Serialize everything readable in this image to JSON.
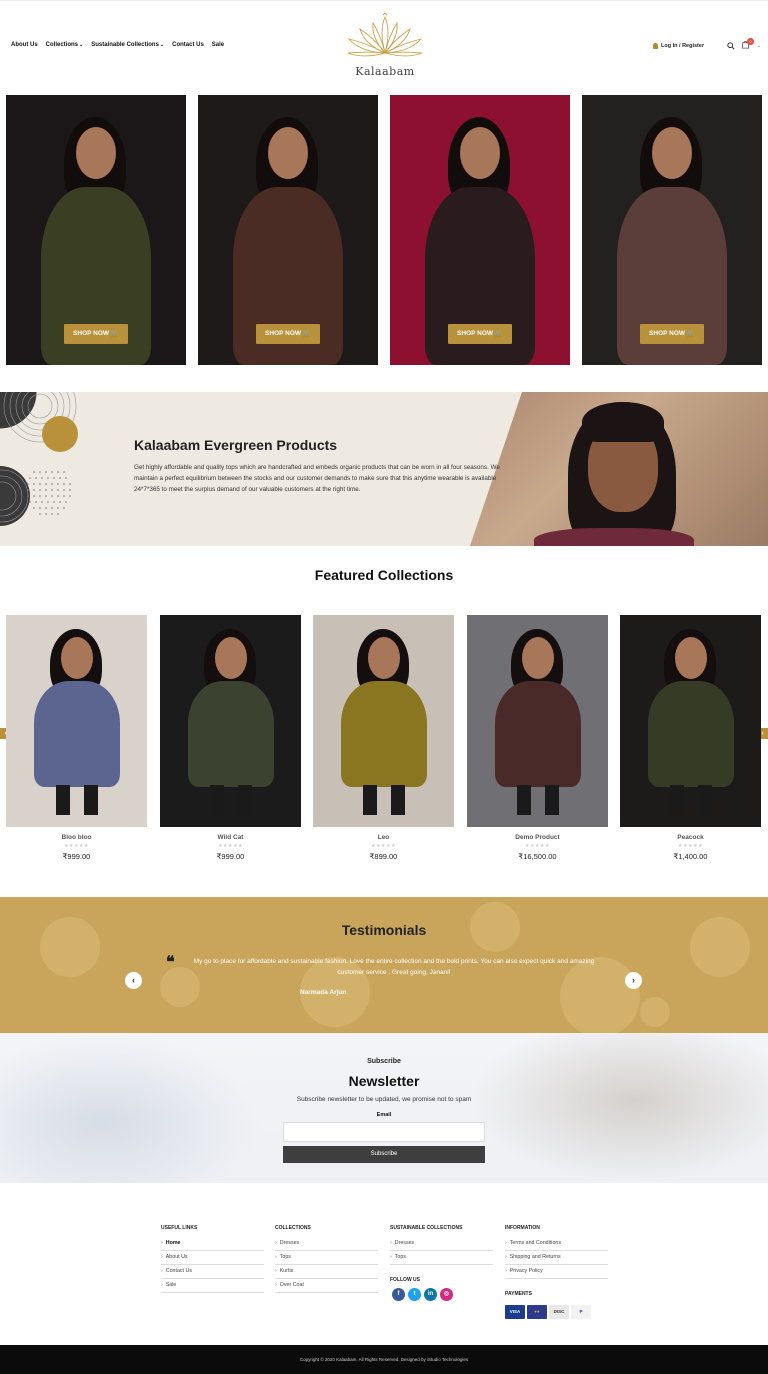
{
  "header": {
    "nav": [
      {
        "label": "About Us",
        "has_dropdown": false
      },
      {
        "label": "Collections",
        "has_dropdown": true
      },
      {
        "label": "Sustainable Collections",
        "has_dropdown": true
      },
      {
        "label": "Contact Us",
        "has_dropdown": false
      },
      {
        "label": "Sale",
        "has_dropdown": false
      }
    ],
    "logo_text": "Kalaabam",
    "login_label": "Log In / Register",
    "cart_count": "0"
  },
  "hero": {
    "cards": [
      {
        "button": "SHOP NOW",
        "bg": "#1b1718",
        "outfit": "#3a3f24"
      },
      {
        "button": "SHOP NOW",
        "bg": "#1e1a19",
        "outfit": "#4a2c24"
      },
      {
        "button": "SHOP NOW",
        "bg": "#8e1030",
        "outfit": "#2a1c1e"
      },
      {
        "button": "SHOP NOW",
        "bg": "#232020",
        "outfit": "#5b3d3a"
      }
    ]
  },
  "evergreen": {
    "title": "Kalaabam Evergreen Products",
    "text": "Get highly affordable and quality tops which are handcrafted and embeds organic products that can be worn in all four seasons. We maintain a perfect equilibrium between the stocks and our customer demands to make sure that this anytime wearable is available 24*7*365 to meet the surplus demand of our valuable customers at the right time."
  },
  "featured": {
    "title": "Featured Collections",
    "products": [
      {
        "name": "Bloo bloo",
        "price": "₹999.00",
        "bg": "#d8d2cb",
        "outfit": "#5b6590"
      },
      {
        "name": "Wild Cat",
        "price": "₹999.00",
        "bg": "#1c1b1b",
        "outfit": "#3b4330"
      },
      {
        "name": "Leo",
        "price": "₹899.00",
        "bg": "#c8c0b6",
        "outfit": "#8a7520"
      },
      {
        "name": "Demo Product",
        "price": "₹16,500.00",
        "bg": "#6f6f74",
        "outfit": "#4a2a28"
      },
      {
        "name": "Peacock",
        "price": "₹1,400.00",
        "bg": "#1d1a1a",
        "outfit": "#363b26"
      }
    ],
    "stars": "★★★★★"
  },
  "testimonials": {
    "title": "Testimonials",
    "quote": "My go to place for affordable and sustainable fashion. Love the entire collection and the bold prints. You can also expect quick and amazing customer service . Great going, Janani!",
    "author": "Narmada Arjun"
  },
  "newsletter": {
    "subtitle": "Subscribe",
    "title": "Newsletter",
    "description": "Subscribe newsletter to be updated, we promise not to spam",
    "email_label": "Email",
    "email_value": "",
    "button": "Subscribe"
  },
  "footer": {
    "useful_links": {
      "title": "USEFUL LINKS",
      "items": [
        "Home",
        "About Us",
        "Contact Us",
        "Sale"
      ]
    },
    "collections": {
      "title": "COLLECTIONS",
      "items": [
        "Dresses",
        "Tops",
        "Kurtis",
        "Over Coat"
      ]
    },
    "sustainable": {
      "title": "SUSTAINABLE COLLECTIONS",
      "items": [
        "Dresses",
        "Tops"
      ]
    },
    "information": {
      "title": "INFORMATION",
      "items": [
        "Terms and Conditions",
        "Shipping and Returns",
        "Privacy Policy"
      ]
    },
    "follow_title": "FOLLOW US",
    "social": [
      {
        "icon": "facebook-icon",
        "glyph": "f",
        "color": "#3b5998"
      },
      {
        "icon": "twitter-icon",
        "glyph": "t",
        "color": "#1da1f2"
      },
      {
        "icon": "linkedin-icon",
        "glyph": "in",
        "color": "#0e76a8"
      },
      {
        "icon": "instagram-icon",
        "glyph": "◎",
        "color": "#d6297b"
      }
    ],
    "payments_title": "PAYMENTS",
    "payments": [
      {
        "label": "VISA",
        "bg": "#1a3e8c",
        "fg": "#fff"
      },
      {
        "label": "●●",
        "bg": "#2b3a8c",
        "fg": "#f79e1b"
      },
      {
        "label": "DISC",
        "bg": "#e8e8e8",
        "fg": "#333"
      },
      {
        "label": "P",
        "bg": "#f2f2f2",
        "fg": "#1a3e8c"
      }
    ],
    "copyright": "Copyright © 2020 Kalaabam. All Rights Reserved. Designed by iStudio Technologies"
  },
  "colors": {
    "accent": "#b8913a",
    "testimonials_bg": "#c8a55a",
    "dark": "#0b0b0b"
  }
}
